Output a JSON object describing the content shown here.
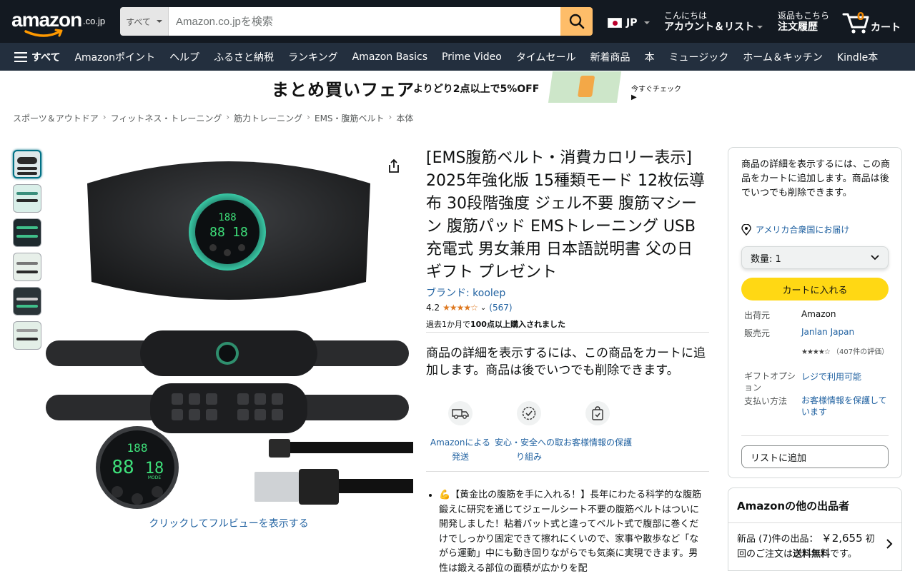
{
  "header": {
    "logo_text": "amazon",
    "logo_tld": ".co.jp",
    "search": {
      "category": "すべて",
      "placeholder": "Amazon.co.jpを検索"
    },
    "language": "JP",
    "account_line1": "こんにちは",
    "account_line2": "アカウント＆リスト",
    "orders_line1": "返品もこちら",
    "orders_line2": "注文履歴",
    "cart_count": "0",
    "cart_label": "カート",
    "colors": {
      "nav_top": "#131921",
      "nav_main": "#232f3e",
      "search_button": "#febd69",
      "cart_count": "#f08804"
    }
  },
  "nav": {
    "all_label": "すべて",
    "links": [
      "Amazonポイント",
      "ヘルプ",
      "ふるさと納税",
      "ランキング",
      "Amazon Basics",
      "Prime Video",
      "タイムセール",
      "新着商品",
      "本",
      "ミュージック",
      "ホーム＆キッチン",
      "Kindle本"
    ]
  },
  "promo": {
    "title": "まとめ買いフェア",
    "subtitle": "よりどり2点以上で5%OFF",
    "link": "今すぐチェック ▶"
  },
  "breadcrumb": [
    "スポーツ＆アウトドア",
    "フィットネス・トレーニング",
    "筋力トレーニング",
    "EMS・腹筋ベルト",
    "本体"
  ],
  "gallery": {
    "thumbnail_count": 6,
    "fullview_link": "クリックしてフルビューを表示する",
    "display_digits": "188",
    "display_big": "88",
    "display_right": "18",
    "display_mode": "MODE"
  },
  "product": {
    "title": "[EMS腹筋ベルト・消費カロリー表示] 2025年強化版 15種類モード 12枚伝導布 30段階強度 ジェル不要 腹筋マシーン 腹筋パッド EMSトレーニング USB充電式 男女兼用 日本語説明書 父の日ギフト プレゼント",
    "brand": "ブランド: koolep",
    "rating_value": "4.2",
    "rating_stars": "★★★★☆",
    "rating_count": "(567)",
    "bought_prefix": "過去1か月で",
    "bought_bold": "100点以上購入されました",
    "detail_message": "商品の詳細を表示するには、この商品をカートに追加します。商品は後でいつでも削除できます。",
    "features": [
      {
        "label": "Amazonによる発送",
        "icon": "truck-icon"
      },
      {
        "label": "安心・安全への取り組み",
        "icon": "badge-check-icon"
      },
      {
        "label": "お客様情報の保護",
        "icon": "secure-bag-icon"
      }
    ],
    "bullet_1": "💪【黄金比の腹筋を手に入れる！】長年にわたる科学的な腹筋鍛えに研究を通じてジェールシート不要の腹筋ベルトはついに開発しました！粘着パット式と違ってベルト式で腹部に巻くだけでしっかり固定できて擦れにくいので、家事や散歩など「ながら運動」中にも動き回りながらでも気楽に実現できます。男性は鍛える部位の面積が広かりを配"
  },
  "buybox": {
    "message": "商品の詳細を表示するには、この商品をカートに追加します。商品は後でいつでも削除できます。",
    "deliver_to": "アメリカ合衆国にお届け",
    "quantity_label": "数量: 1",
    "add_to_cart": "カートに入れる",
    "shipper_label": "出荷元",
    "shipper_value": "Amazon",
    "seller_label": "販売元",
    "seller_value": "Janlan Japan",
    "seller_stars": "★★★★☆",
    "seller_rating_text": "（407件の評価）",
    "gift_label": "ギフトオプション",
    "gift_value": "レジで利用可能",
    "payment_label": "支払い方法",
    "payment_value": "お客様情報を保護しています",
    "add_to_list": "リストに追加",
    "button_color": "#ffd814"
  },
  "other_sellers": {
    "title": "Amazonの他の出品者",
    "new_label": "新品 (7)件の出品：",
    "price": "￥2,655",
    "first_order": "初回のご注文は",
    "free_shipping": "送料無料",
    "suffix": "です。"
  }
}
